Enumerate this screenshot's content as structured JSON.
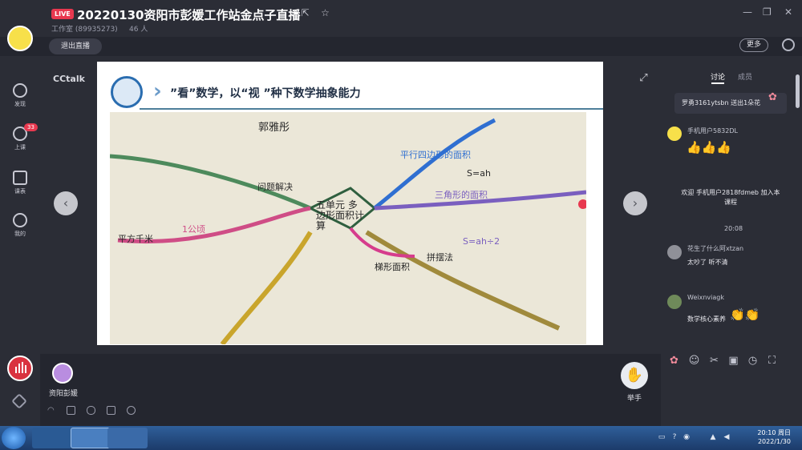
{
  "app": {
    "live_badge": "LIVE",
    "title": "20220130资阳市彭媛工作站金点子直播",
    "subtitle": "工作室 (89935273)",
    "viewers": "46 人",
    "exit_label": "退出直播",
    "more_label": "更多",
    "brand": "CCtalk"
  },
  "sidebar": {
    "items": [
      {
        "label": "发现",
        "icon": "compass-icon"
      },
      {
        "label": "上课",
        "icon": "chat-bubble-icon",
        "badge": "33"
      },
      {
        "label": "课表",
        "icon": "calendar-icon"
      },
      {
        "label": "我的",
        "icon": "person-icon"
      }
    ]
  },
  "slide": {
    "title": "”看”数学，以“视 ”种下数学抽象能力",
    "center_node": "五单元 多边形面积计算",
    "nodes": [
      "郭雅彤",
      "问题解决",
      "平行四边形的面积",
      "三角形的面积",
      "梯形面积",
      "S=ah",
      "S=ah÷2",
      "拼摆法",
      "1公顷",
      "平方千米"
    ]
  },
  "student": {
    "name": "资阳彭媛",
    "raise_label": "举手"
  },
  "chat": {
    "tabs": [
      "讨论",
      "成员"
    ],
    "gift": "罗勇3161ytsbn 送出1朵花",
    "messages": [
      {
        "name": "手机用户5832DL",
        "text": "👍👍👍"
      },
      {
        "welcome": "欢迎 手机用户2818fdmeb 加入本课程"
      },
      {
        "time": "20:08"
      },
      {
        "name": "花生了什么阿xtzan",
        "text": "太吵了 听不清"
      },
      {
        "name": "Weixnviagk",
        "text": "数学核心素养"
      }
    ]
  },
  "taskbar": {
    "time": "20:10 周日",
    "date": "2022/1/30"
  },
  "colors": {
    "accent_red": "#e8384f",
    "chat_bg": "#2b2d36",
    "stage_bg": "#24262f"
  }
}
